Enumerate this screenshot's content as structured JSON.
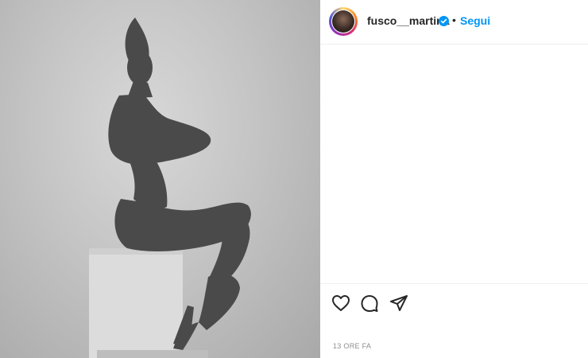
{
  "post": {
    "username": "fusco__martina",
    "separator": "•",
    "follow_label": "Segui",
    "timestamp": "13 ORE FA"
  },
  "icons": {
    "verified": "verified-badge-icon",
    "like": "heart-icon",
    "comment": "comment-icon",
    "share": "send-icon"
  },
  "colors": {
    "accent": "#0095f6",
    "text": "#262626",
    "muted": "#8e8e8e",
    "divider": "#efefef"
  }
}
